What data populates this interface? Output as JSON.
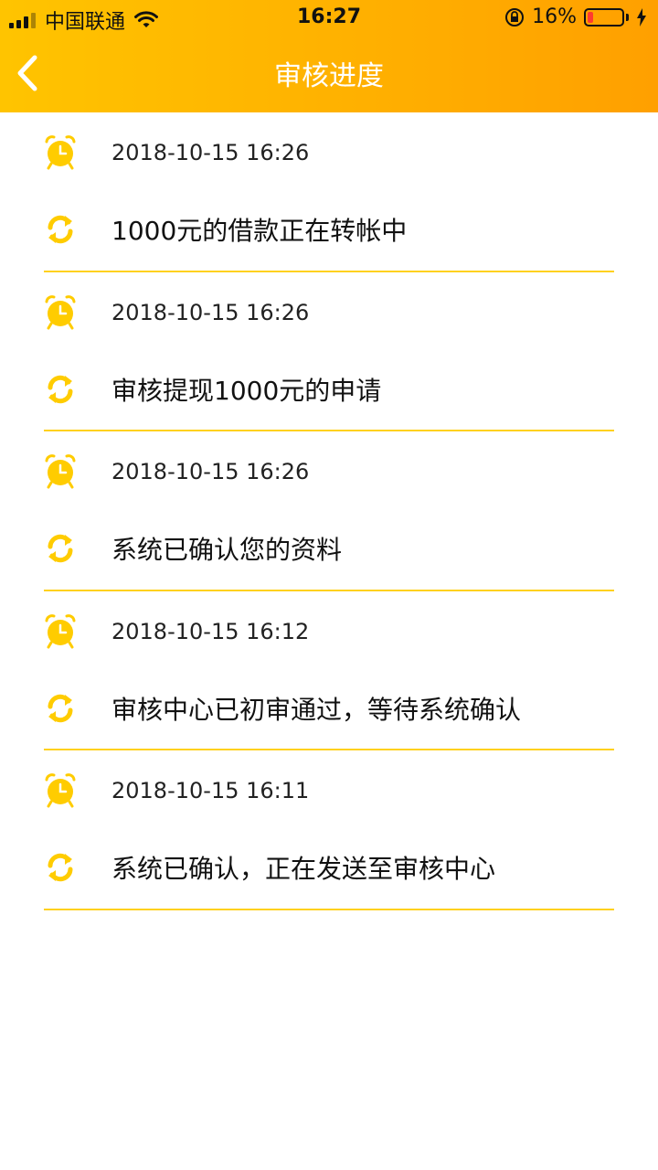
{
  "status": {
    "carrier": "中国联通",
    "time": "16:27",
    "battery_percent": "16%",
    "battery_level": 0.16
  },
  "nav": {
    "title": "审核进度",
    "back_icon": "chevron-left-icon"
  },
  "colors": {
    "header_start": "#FFC400",
    "header_end": "#FFA000",
    "accent": "#FFD11E"
  },
  "progress": [
    {
      "time": "2018-10-15 16:26",
      "message": "1000元的借款正在转帐中"
    },
    {
      "time": "2018-10-15 16:26",
      "message": "审核提现1000元的申请"
    },
    {
      "time": "2018-10-15 16:26",
      "message": "系统已确认您的资料"
    },
    {
      "time": "2018-10-15 16:12",
      "message": "审核中心已初审通过，等待系统确认"
    },
    {
      "time": "2018-10-15 16:11",
      "message": "系统已确认，正在发送至审核中心"
    }
  ]
}
